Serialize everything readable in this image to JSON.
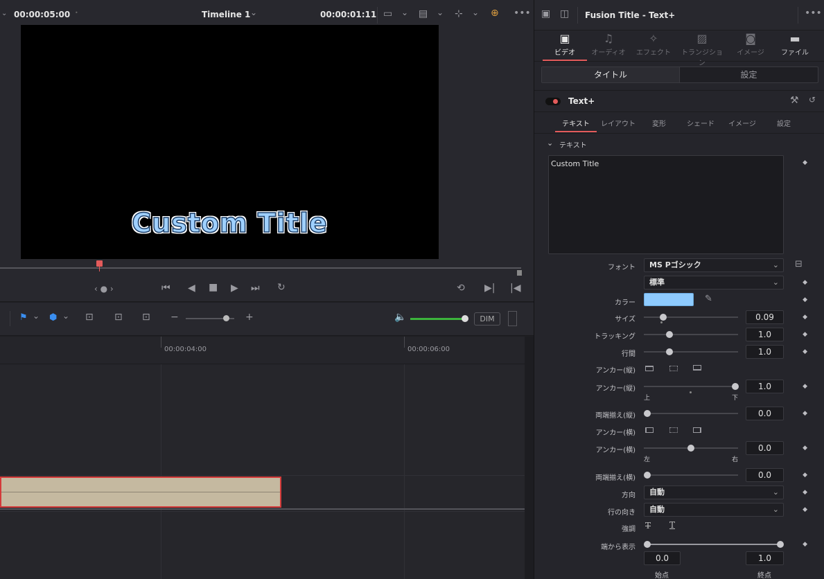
{
  "viewer": {
    "left_timecode": "00:00:05:00",
    "timeline_name": "Timeline 1",
    "current_timecode": "00:00:01:11",
    "preview_text": "Custom Title",
    "dim_label": "DIM"
  },
  "timeline": {
    "ruler_labels": [
      "00:00:04:00",
      "00:00:06:00"
    ],
    "clip_color": "#c5b9a0"
  },
  "inspector": {
    "title": "Fusion Title - Text+",
    "categories": [
      "ビデオ",
      "オーディオ",
      "エフェクト",
      "トランジション",
      "イメージ",
      "ファイル"
    ],
    "active_category": "ビデオ",
    "seg_tabs": [
      "タイトル",
      "設定"
    ],
    "node_name": "Text+",
    "sub_tabs": [
      "テキスト",
      "レイアウト",
      "変形",
      "シェード",
      "イメージ",
      "設定"
    ],
    "section_title": "テキスト",
    "text_value": "Custom Title",
    "font_label": "フォント",
    "font_value": "MS Pゴシック",
    "style_value": "標準",
    "color_label": "カラー",
    "color_value": "#8ecbff",
    "size_label": "サイズ",
    "size_value": "0.09",
    "tracking_label": "トラッキング",
    "tracking_value": "1.0",
    "line_spacing_label": "行間",
    "line_spacing_value": "1.0",
    "anchor_v_label": "アンカー(縦)",
    "anchor_v2_label": "アンカー(縦)",
    "anchor_v_value": "1.0",
    "anchor_v_top": "上",
    "anchor_v_bottom": "下",
    "justify_v_label": "両端揃え(縦)",
    "justify_v_value": "0.0",
    "anchor_h_label": "アンカー(横)",
    "anchor_h2_label": "アンカー(横)",
    "anchor_h_value": "0.0",
    "anchor_h_left": "左",
    "anchor_h_right": "右",
    "justify_h_label": "両端揃え(横)",
    "justify_h_value": "0.0",
    "direction_label": "方向",
    "direction_value": "自動",
    "line_dir_label": "行の向き",
    "line_dir_value": "自動",
    "emphasis_label": "強調",
    "write_on_label": "端から表示",
    "write_on_start": "0.0",
    "write_on_end": "1.0",
    "start_label": "始点",
    "end_label": "終点",
    "accent_color": "#e35b5b"
  }
}
